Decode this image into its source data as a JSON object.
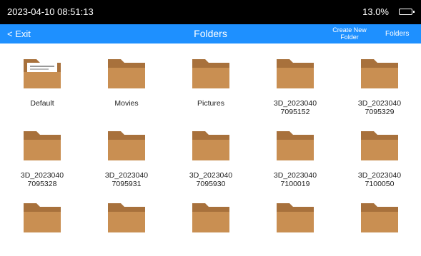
{
  "status_bar": {
    "time": "2023-04-10 08:51:13",
    "battery_percent": "13.0%"
  },
  "title_bar": {
    "exit_label": "Exit",
    "title": "Folders",
    "create_new_folder_line1": "Create New",
    "create_new_folder_line2": "Folder",
    "folders_label": "Folders"
  },
  "folders": [
    {
      "line1": "Default",
      "line2": ""
    },
    {
      "line1": "Movies",
      "line2": ""
    },
    {
      "line1": "Pictures",
      "line2": ""
    },
    {
      "line1": "3D_2023040",
      "line2": "7095152"
    },
    {
      "line1": "3D_2023040",
      "line2": "7095329"
    },
    {
      "line1": "3D_2023040",
      "line2": "7095328"
    },
    {
      "line1": "3D_2023040",
      "line2": "7095931"
    },
    {
      "line1": "3D_2023040",
      "line2": "7095930"
    },
    {
      "line1": "3D_2023040",
      "line2": "7100019"
    },
    {
      "line1": "3D_2023040",
      "line2": "7100050"
    },
    {
      "line1": "",
      "line2": ""
    },
    {
      "line1": "",
      "line2": ""
    },
    {
      "line1": "",
      "line2": ""
    },
    {
      "line1": "",
      "line2": ""
    },
    {
      "line1": "",
      "line2": ""
    }
  ],
  "colors": {
    "title_bar": "#1e90ff",
    "status_bar": "#000000",
    "folder": "#c98f52"
  }
}
